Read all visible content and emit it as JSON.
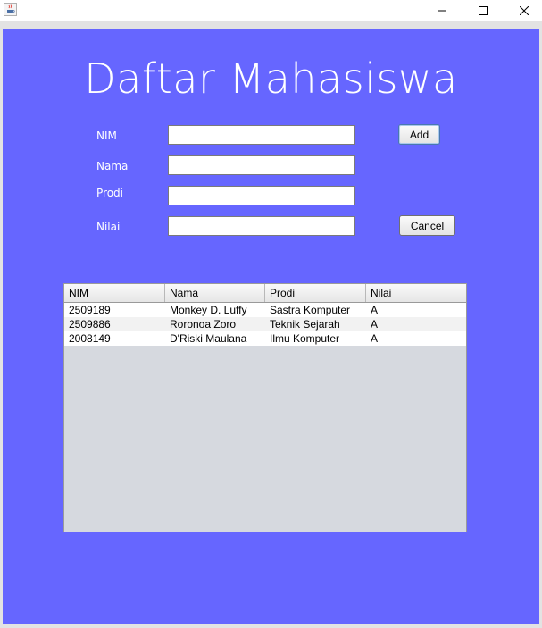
{
  "window": {
    "icon": "java-cup-icon"
  },
  "form": {
    "title": "Daftar Mahasiswa",
    "fields": [
      {
        "label": "NIM",
        "value": ""
      },
      {
        "label": "Nama",
        "value": ""
      },
      {
        "label": "Prodi",
        "value": ""
      },
      {
        "label": "Nilai",
        "value": ""
      }
    ],
    "add_label": "Add",
    "cancel_label": "Cancel"
  },
  "table": {
    "columns": [
      "NIM",
      "Nama",
      "Prodi",
      "Nilai"
    ],
    "rows": [
      [
        "2509189",
        "Monkey D. Luffy",
        "Sastra Komputer",
        "A"
      ],
      [
        "2509886",
        "Roronoa Zoro",
        "Teknik Sejarah",
        "A"
      ],
      [
        "2008149",
        "D'Riski Maulana",
        "Ilmu Komputer",
        "A"
      ]
    ]
  },
  "colors": {
    "background": "#6666ff",
    "table_empty": "#d6d9df"
  }
}
